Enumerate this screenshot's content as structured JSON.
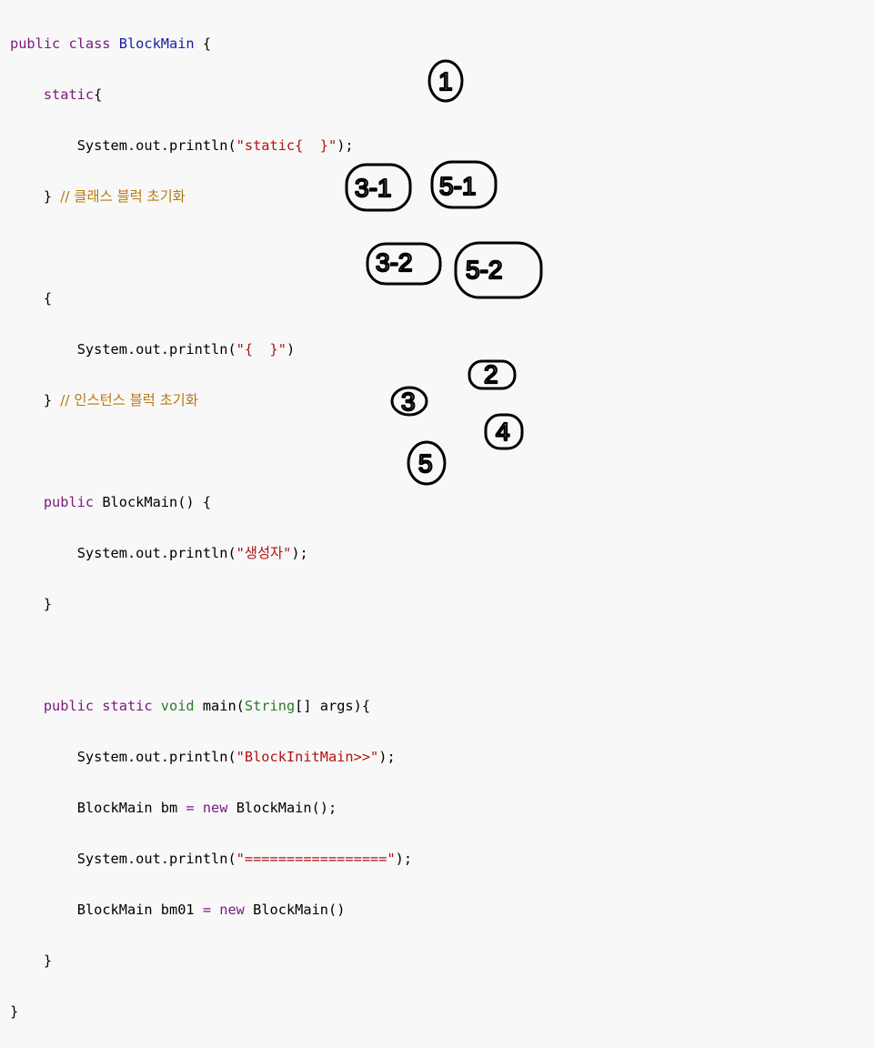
{
  "code": {
    "l1": {
      "kw": "public class ",
      "cls": "BlockMain",
      "rest": " {"
    },
    "l2": {
      "indent": "    ",
      "kw": "static",
      "rest": "{"
    },
    "l3": {
      "indent": "        ",
      "pre": "System.out.println(",
      "str": "\"static{  }\"",
      "post": ");"
    },
    "l4": {
      "indent": "    ",
      "pre": "} ",
      "cmt": "// 클래스 블럭 초기화"
    },
    "l6": {
      "indent": "    ",
      "pre": "{"
    },
    "l7": {
      "indent": "        ",
      "pre": "System.out.println(",
      "str": "\"{  }\"",
      "post": ")"
    },
    "l8": {
      "indent": "    ",
      "pre": "} ",
      "cmt": "// 인스턴스 블럭 초기화"
    },
    "l10": {
      "indent": "    ",
      "kw": "public ",
      "rest": "BlockMain() {"
    },
    "l11": {
      "indent": "        ",
      "pre": "System.out.println(",
      "str": "\"생성자\"",
      "post": ");"
    },
    "l12": {
      "indent": "    ",
      "pre": "}"
    },
    "l14": {
      "indent": "    ",
      "kw1": "public static ",
      "type1": "void ",
      "mid": "main(",
      "type2": "String",
      "rest": "[] args){"
    },
    "l15": {
      "indent": "        ",
      "pre": "System.out.println(",
      "str": "\"BlockInitMain>>\"",
      "post": ");"
    },
    "l16": {
      "indent": "        ",
      "pre": "BlockMain bm ",
      "op": "= ",
      "kw": "new ",
      "rest": "BlockMain();"
    },
    "l17": {
      "indent": "        ",
      "pre": "System.out.println(",
      "str": "\"=================\"",
      "post": ");"
    },
    "l18": {
      "indent": "        ",
      "pre": "BlockMain bm01 ",
      "op": "= ",
      "kw": "new ",
      "rest": "BlockMain()"
    },
    "l19": {
      "indent": "    ",
      "pre": "}"
    },
    "l20": {
      "pre": "}"
    }
  },
  "annotations": {
    "a1": "1",
    "a2": "2",
    "a3": "3",
    "a4": "4",
    "a5": "5",
    "a31": "3-1",
    "a32": "3-2",
    "a51": "5-1",
    "a52": "5-2"
  }
}
